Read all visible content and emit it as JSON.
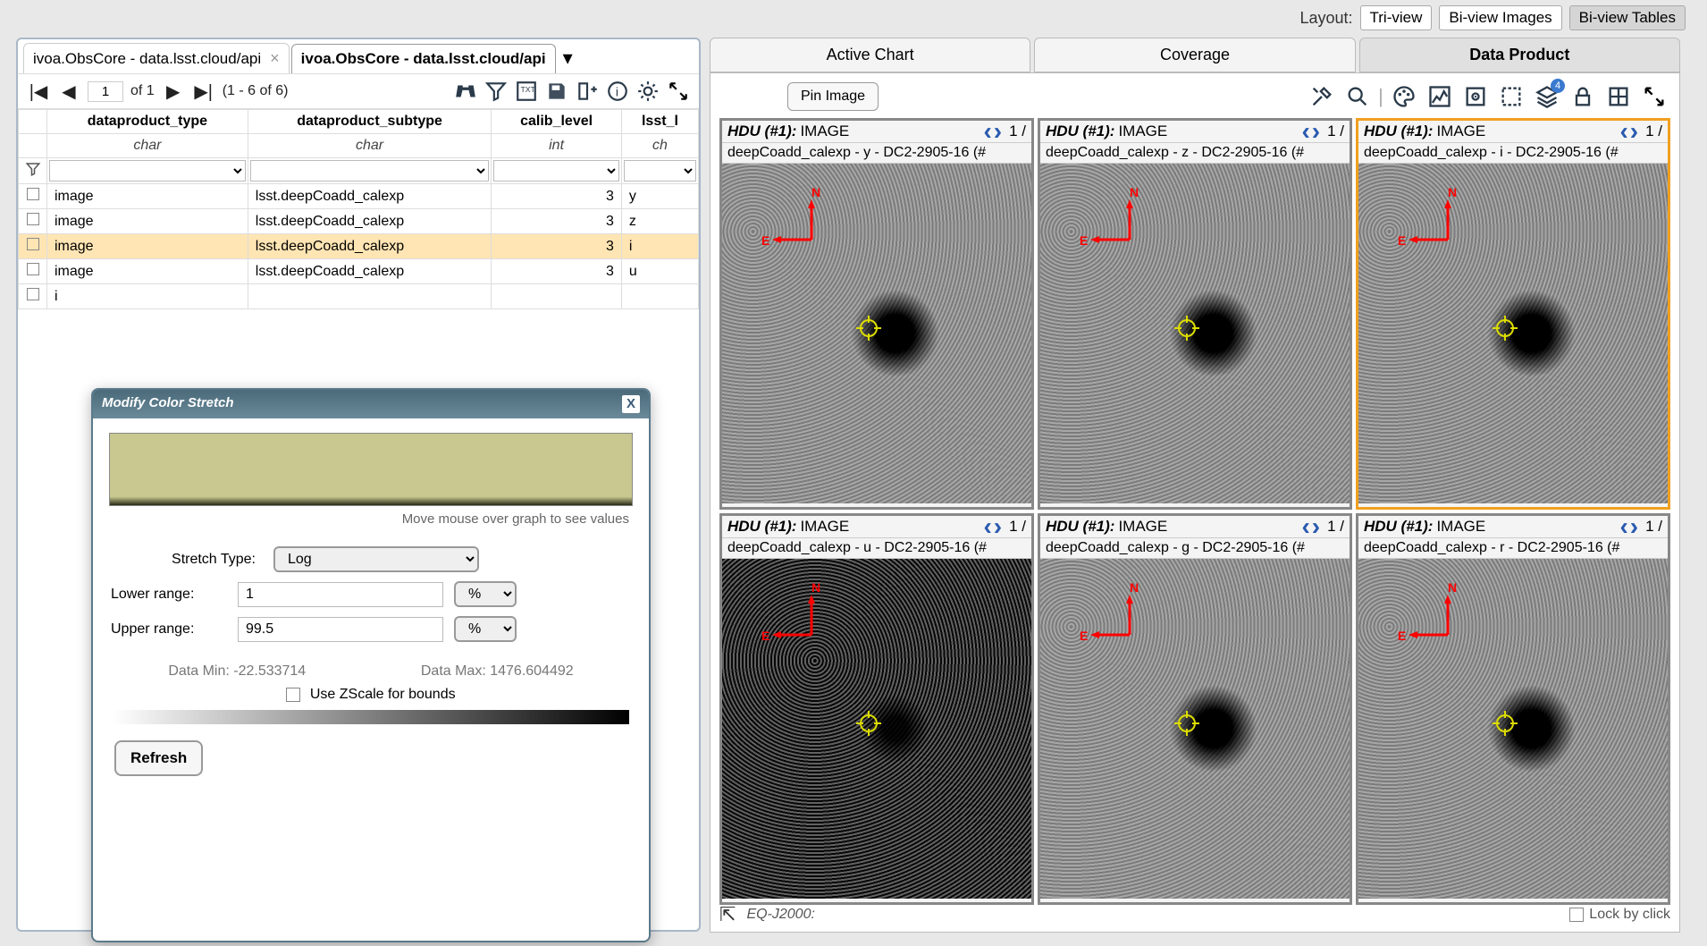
{
  "layout": {
    "label": "Layout:",
    "options": [
      "Tri-view",
      "Bi-view Images",
      "Bi-view Tables"
    ],
    "active": 2
  },
  "leftTabs": [
    {
      "label": "ivoa.ObsCore - data.lsst.cloud/api",
      "active": false
    },
    {
      "label": "ivoa.ObsCore - data.lsst.cloud/api",
      "active": true
    }
  ],
  "pager": {
    "page": "1",
    "of": "of 1",
    "range": "(1 - 6 of 6)"
  },
  "cols": [
    {
      "name": "dataproduct_type",
      "type": "char"
    },
    {
      "name": "dataproduct_subtype",
      "type": "char"
    },
    {
      "name": "calib_level",
      "type": "int"
    },
    {
      "name": "lsst_l",
      "type": "ch"
    }
  ],
  "rows": [
    {
      "c": [
        "image",
        "lsst.deepCoadd_calexp",
        "3",
        "y"
      ],
      "sel": false
    },
    {
      "c": [
        "image",
        "lsst.deepCoadd_calexp",
        "3",
        "z"
      ],
      "sel": false
    },
    {
      "c": [
        "image",
        "lsst.deepCoadd_calexp",
        "3",
        "i"
      ],
      "sel": true
    },
    {
      "c": [
        "image",
        "lsst.deepCoadd_calexp",
        "3",
        "u"
      ],
      "sel": false
    }
  ],
  "partialRow0": "i",
  "dialog": {
    "title": "Modify Color Stretch",
    "graphHint": "Move mouse over graph to see values",
    "stretchTypeLabel": "Stretch Type:",
    "stretchType": "Log",
    "lowerLabel": "Lower range:",
    "lower": "1",
    "lowerUnit": "%",
    "upperLabel": "Upper range:",
    "upper": "99.5",
    "upperUnit": "%",
    "dataMin": "Data Min: -22.533714",
    "dataMax": "Data Max: 1476.604492",
    "zscale": "Use ZScale for bounds",
    "refresh": "Refresh"
  },
  "rightTabs": [
    "Active Chart",
    "Coverage",
    "Data Product"
  ],
  "rightActive": 2,
  "pinLabel": "Pin Image",
  "toolbarBadge": "4",
  "cells": [
    {
      "hdu": "HDU (#1):",
      "type": "IMAGE",
      "cnt": "1 /",
      "sub": "deepCoadd_calexp - y - DC2-2905-16 (#",
      "sel": false,
      "dark": false
    },
    {
      "hdu": "HDU (#1):",
      "type": "IMAGE",
      "cnt": "1 /",
      "sub": "deepCoadd_calexp - z - DC2-2905-16 (#",
      "sel": false,
      "dark": false
    },
    {
      "hdu": "HDU (#1):",
      "type": "IMAGE",
      "cnt": "1 /",
      "sub": "deepCoadd_calexp - i - DC2-2905-16 (#",
      "sel": true,
      "dark": false
    },
    {
      "hdu": "HDU (#1):",
      "type": "IMAGE",
      "cnt": "1 /",
      "sub": "deepCoadd_calexp - u - DC2-2905-16 (#",
      "sel": false,
      "dark": true
    },
    {
      "hdu": "HDU (#1):",
      "type": "IMAGE",
      "cnt": "1 /",
      "sub": "deepCoadd_calexp - g - DC2-2905-16 (#",
      "sel": false,
      "dark": false
    },
    {
      "hdu": "HDU (#1):",
      "type": "IMAGE",
      "cnt": "1 /",
      "sub": "deepCoadd_calexp - r - DC2-2905-16 (#",
      "sel": false,
      "dark": false
    }
  ],
  "footer": {
    "coord": "EQ-J2000:",
    "lock": "Lock by click"
  }
}
